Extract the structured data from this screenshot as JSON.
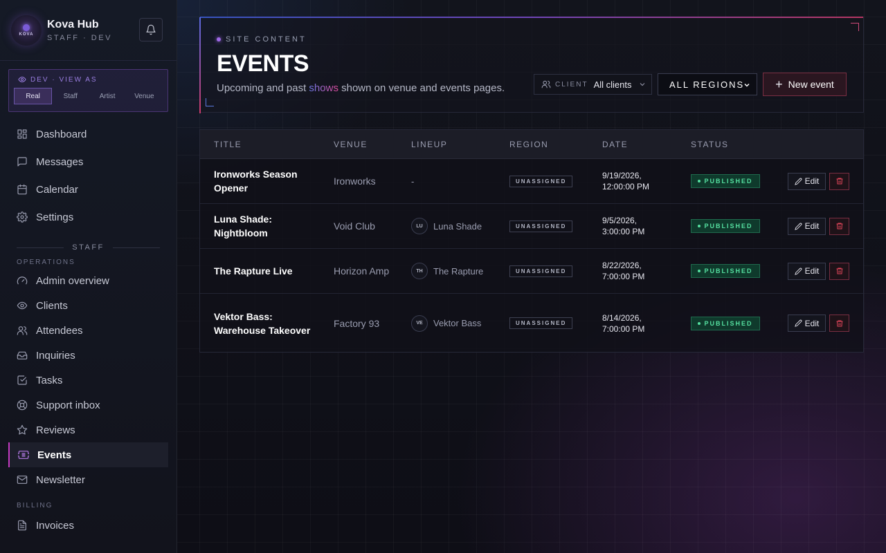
{
  "brand": {
    "logo_text": "KOVA",
    "name": "Kova Hub",
    "subtitle": "STAFF · DEV"
  },
  "view_as": {
    "title": "DEV · VIEW AS",
    "tabs": [
      {
        "label": "Real",
        "active": true
      },
      {
        "label": "Staff",
        "active": false
      },
      {
        "label": "Artist",
        "active": false
      },
      {
        "label": "Venue",
        "active": false
      }
    ]
  },
  "nav": {
    "main": [
      {
        "label": "Dashboard",
        "icon": "dashboard-icon"
      },
      {
        "label": "Messages",
        "icon": "message-icon"
      },
      {
        "label": "Calendar",
        "icon": "calendar-icon"
      },
      {
        "label": "Settings",
        "icon": "gear-icon"
      }
    ],
    "staff_divider": "STAFF",
    "operations_label": "OPERATIONS",
    "operations": [
      {
        "label": "Admin overview",
        "icon": "gauge-icon"
      },
      {
        "label": "Clients",
        "icon": "eye-icon"
      },
      {
        "label": "Attendees",
        "icon": "users-icon"
      },
      {
        "label": "Inquiries",
        "icon": "inbox-icon"
      },
      {
        "label": "Tasks",
        "icon": "checkbox-icon"
      },
      {
        "label": "Support inbox",
        "icon": "lifebuoy-icon"
      },
      {
        "label": "Reviews",
        "icon": "star-icon"
      },
      {
        "label": "Events",
        "icon": "ticket-icon",
        "active": true
      },
      {
        "label": "Newsletter",
        "icon": "mail-icon"
      }
    ],
    "billing_label": "BILLING",
    "billing": [
      {
        "label": "Invoices",
        "icon": "document-icon"
      }
    ]
  },
  "header": {
    "eyebrow": "SITE CONTENT",
    "title": "EVENTS",
    "desc_before": "Upcoming and past ",
    "desc_highlight": "shows",
    "desc_after": " shown on venue and events pages.",
    "client_label": "CLIENT",
    "client_value": "All clients",
    "region_value": "ALL REGIONS",
    "new_event_label": "New event"
  },
  "table": {
    "columns": [
      "TITLE",
      "VENUE",
      "LINEUP",
      "REGION",
      "DATE",
      "STATUS"
    ],
    "rows": [
      {
        "title": "Ironworks Season Opener",
        "venue": "Ironworks",
        "lineup_initials": "",
        "lineup": "-",
        "region": "UNASSIGNED",
        "date_line1": "9/19/2026,",
        "date_line2": "12:00:00 PM",
        "status": "PUBLISHED"
      },
      {
        "title": "Luna Shade: Nightbloom",
        "venue": "Void Club",
        "lineup_initials": "LU",
        "lineup": "Luna Shade",
        "region": "UNASSIGNED",
        "date_line1": "9/5/2026,",
        "date_line2": "3:00:00 PM",
        "status": "PUBLISHED"
      },
      {
        "title": "The Rapture Live",
        "venue": "Horizon Amp",
        "lineup_initials": "TH",
        "lineup": "The Rapture",
        "region": "UNASSIGNED",
        "date_line1": "8/22/2026,",
        "date_line2": "7:00:00 PM",
        "status": "PUBLISHED"
      },
      {
        "title": "Vektor Bass: Warehouse Takeover",
        "venue": "Factory 93",
        "lineup_initials": "VE",
        "lineup": "Vektor Bass",
        "region": "UNASSIGNED",
        "date_line1": "8/14/2026,",
        "date_line2": "7:00:00 PM",
        "status": "PUBLISHED"
      }
    ],
    "edit_label": "Edit"
  },
  "colors": {
    "accent_purple": "#7a5bd6",
    "accent_pink": "#c23ac0",
    "published_green": "#55e0a0",
    "delete_red": "#e0455a"
  }
}
